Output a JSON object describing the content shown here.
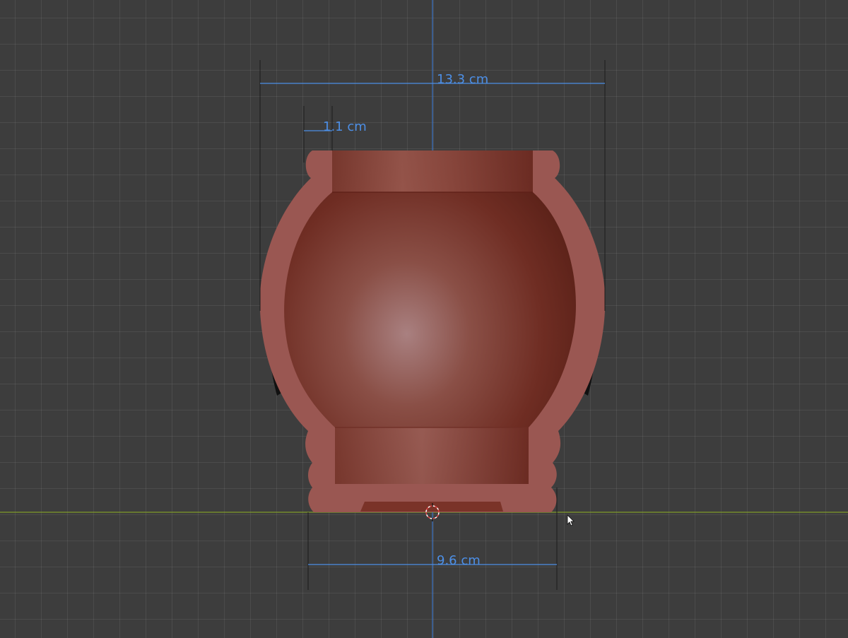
{
  "viewport": {
    "measurements": {
      "overall_width": "13.3 cm",
      "wall_thickness": "1.1 cm",
      "base_width": "9.6 cm"
    }
  },
  "colors": {
    "background": "#3d3d3d",
    "grid_line": "#4a4a4a",
    "x_axis": "#7f9a2a",
    "z_axis": "#3b73c4",
    "measure_line": "#4d8fe6",
    "measure_text": "#4d8fe6",
    "pot_wall": "#9a5752",
    "pot_interior": "#7a3328",
    "pot_highlight": "#b08585"
  },
  "icons": {
    "origin": "3d-cursor-icon",
    "pointer": "mouse-cursor-icon",
    "object": "clay-pot-section"
  }
}
